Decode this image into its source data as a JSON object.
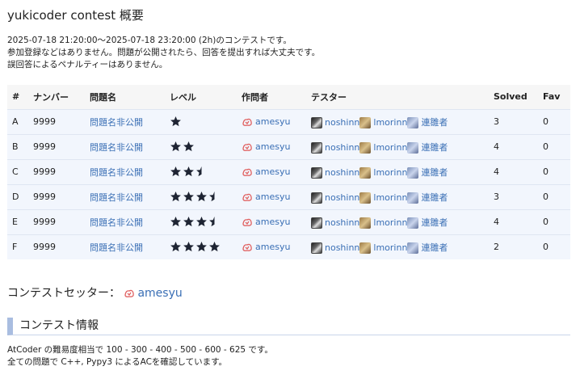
{
  "title": "yukicoder contest 概要",
  "info_lines": [
    "2025-07-18 21:20:00～2025-07-18 23:20:00 (2h)のコンテストです。",
    "参加登録などはありません。問題が公開されたら、回答を提出すれば大丈夫です。",
    "誤回答によるペナルティーはありません。"
  ],
  "table": {
    "headers": [
      "#",
      "ナンバー",
      "問題名",
      "レベル",
      "作問者",
      "テスター",
      "Solved",
      "Fav"
    ],
    "rows": [
      {
        "id": "A",
        "number": "9999",
        "name": "問題名非公開",
        "level": 1,
        "author": "amesyu",
        "testers": [
          "noshinn",
          "lmorinn",
          "連雛者"
        ],
        "solved": "3",
        "fav": "0"
      },
      {
        "id": "B",
        "number": "9999",
        "name": "問題名非公開",
        "level": 2,
        "author": "amesyu",
        "testers": [
          "noshinn",
          "lmorinn",
          "連雛者"
        ],
        "solved": "4",
        "fav": "0"
      },
      {
        "id": "C",
        "number": "9999",
        "name": "問題名非公開",
        "level": 2.5,
        "author": "amesyu",
        "testers": [
          "noshinn",
          "lmorinn",
          "連雛者"
        ],
        "solved": "4",
        "fav": "0"
      },
      {
        "id": "D",
        "number": "9999",
        "name": "問題名非公開",
        "level": 3.5,
        "author": "amesyu",
        "testers": [
          "noshinn",
          "lmorinn",
          "連雛者"
        ],
        "solved": "3",
        "fav": "0"
      },
      {
        "id": "E",
        "number": "9999",
        "name": "問題名非公開",
        "level": 3.5,
        "author": "amesyu",
        "testers": [
          "noshinn",
          "lmorinn",
          "連雛者"
        ],
        "solved": "4",
        "fav": "0"
      },
      {
        "id": "F",
        "number": "9999",
        "name": "問題名非公開",
        "level": 4,
        "author": "amesyu",
        "testers": [
          "noshinn",
          "lmorinn",
          "連雛者"
        ],
        "solved": "2",
        "fav": "0"
      }
    ]
  },
  "setter": {
    "label": "コンテストセッター：",
    "name": "amesyu"
  },
  "section": {
    "title": "コンテスト情報"
  },
  "desc_lines": [
    "AtCoder の難易度相当で 100 - 300 - 400 - 500 - 600 - 625 です。",
    "全ての問題で C++, Pypy3 によるACを確認しています。"
  ],
  "colors": {
    "link": "#3a6fb5",
    "row_bg": "#f2f6fd",
    "star": "#1e2433"
  }
}
